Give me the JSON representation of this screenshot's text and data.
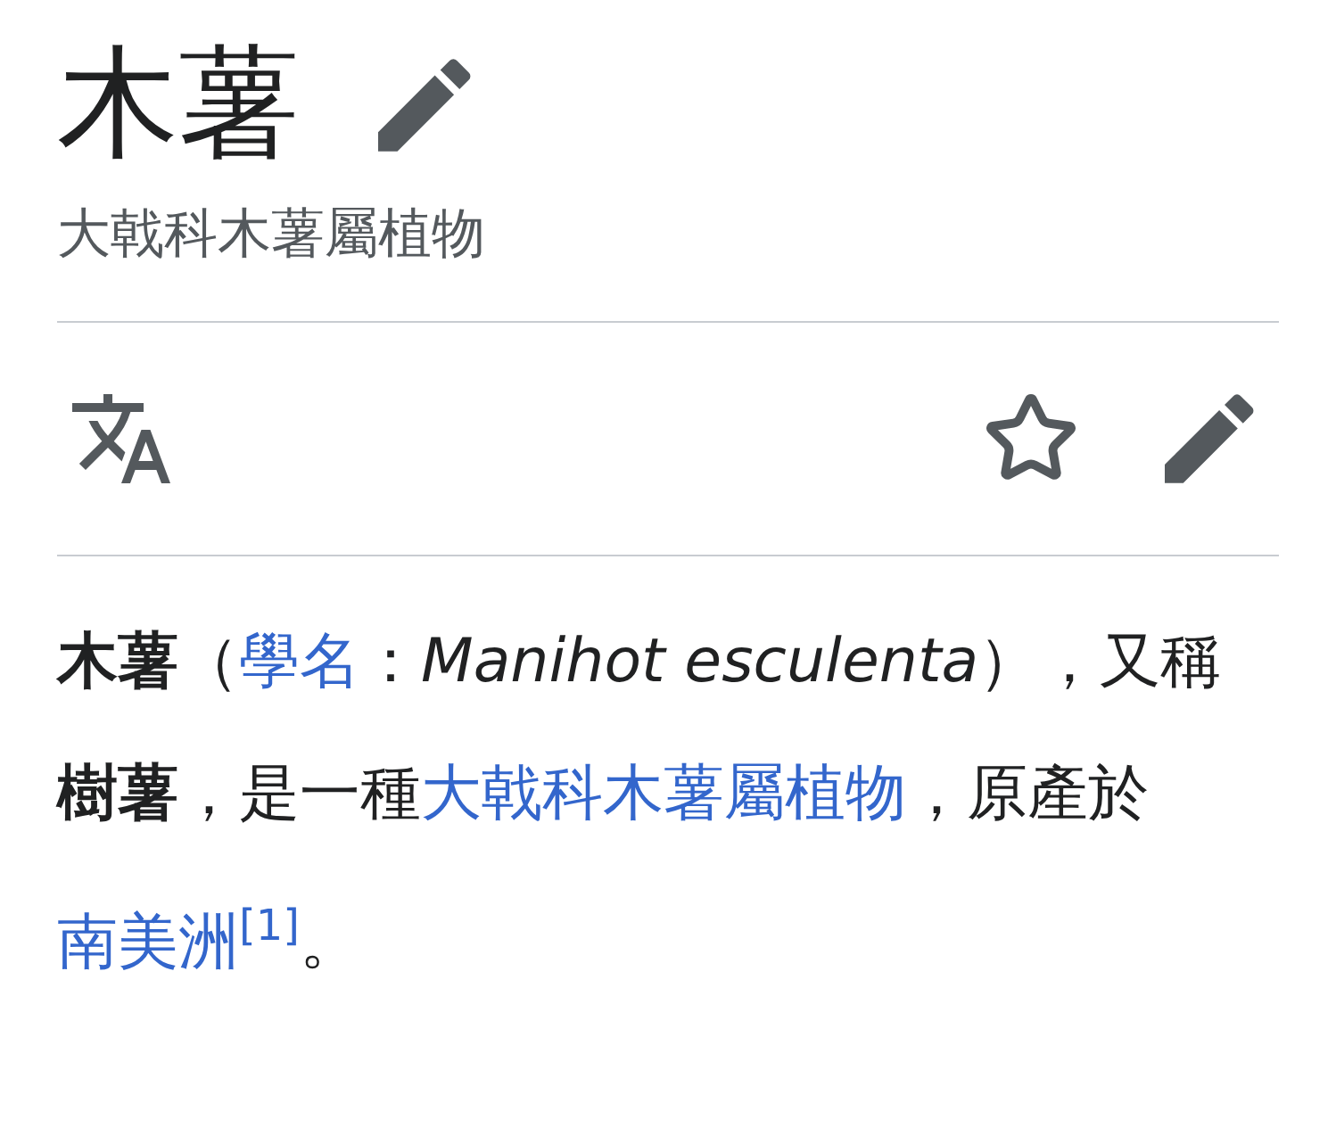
{
  "title": "木薯",
  "subtitle": "大戟科木薯屬植物",
  "paragraph": [
    {
      "kind": "text",
      "text": "**木薯**（"
    },
    {
      "kind": "link",
      "text": "學名"
    },
    {
      "kind": "text",
      "text": "：*Manihot esculenta*），又稱**樹薯**，是一種"
    },
    {
      "kind": "link",
      "text": "大戟科木薯屬植物"
    },
    {
      "kind": "text",
      "text": "，原產於"
    },
    {
      "kind": "link",
      "text": "南美洲"
    },
    {
      "kind": "ref",
      "text": "[1]"
    },
    {
      "kind": "text",
      "text": "。"
    }
  ]
}
